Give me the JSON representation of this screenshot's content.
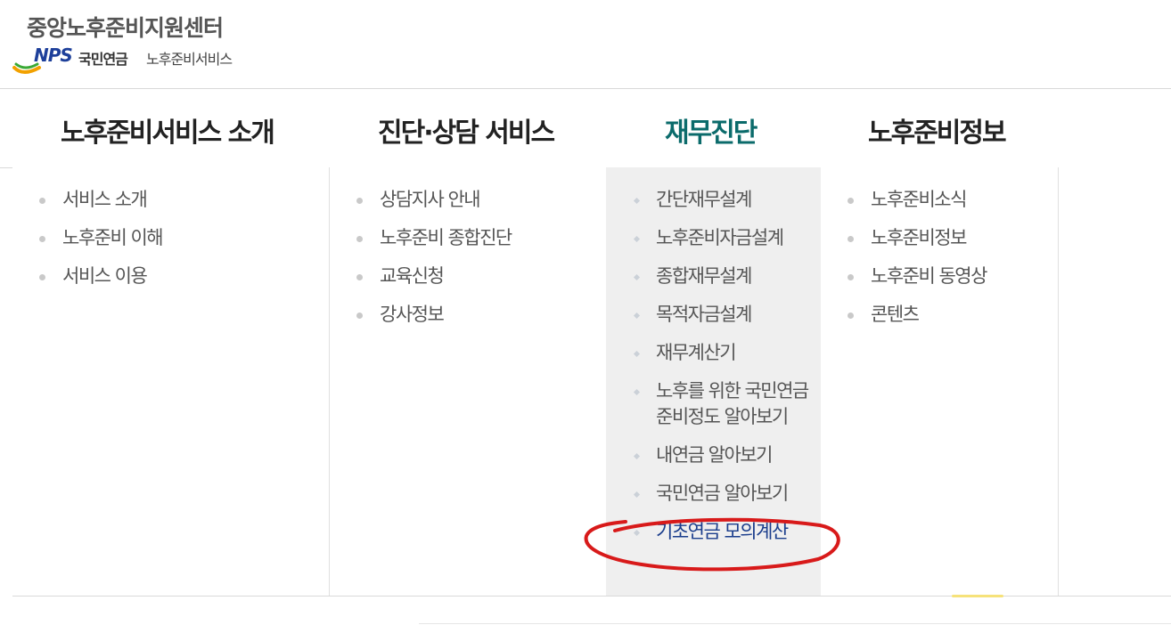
{
  "logo": {
    "title": "중앙노후준비지원센터",
    "nps": "NPS",
    "org": "국민연금",
    "service": "노후준비서비스"
  },
  "gnb": {
    "menus": [
      {
        "label": "노후준비서비스 소개",
        "items": [
          "서비스 소개",
          "노후준비 이해",
          "서비스 이용"
        ]
      },
      {
        "label": "진단·상담 서비스",
        "items": [
          "상담지사 안내",
          "노후준비 종합진단",
          "교육신청",
          "강사정보"
        ]
      },
      {
        "label": "재무진단",
        "active": true,
        "items": [
          "간단재무설계",
          "노후준비자금설계",
          "종합재무설계",
          "목적자금설계",
          "재무계산기",
          "노후를 위한 국민연금 준비정도 알아보기",
          "내연금 알아보기",
          "국민연금 알아보기",
          "기초연금 모의계산"
        ]
      },
      {
        "label": "노후준비정보",
        "items": [
          "노후준비소식",
          "노후준비정보",
          "노후준비 동영상",
          "콘텐츠"
        ]
      }
    ]
  },
  "colors": {
    "active_menu": "#0b6b6b",
    "active_column_bg": "#efefef",
    "highlight_link": "#1a3d8c",
    "annotation": "#d81a1a"
  }
}
